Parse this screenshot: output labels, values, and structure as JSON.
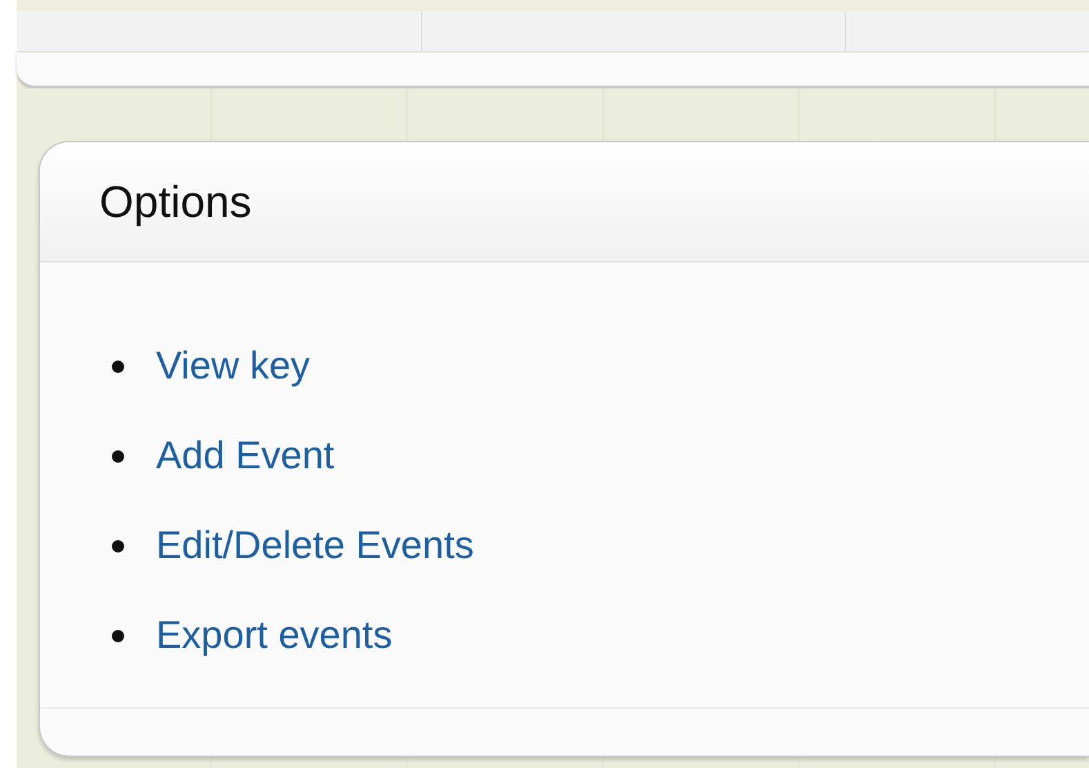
{
  "panel": {
    "title": "Options",
    "links": [
      {
        "label": "View key"
      },
      {
        "label": "Add Event"
      },
      {
        "label": "Edit/Delete Events"
      },
      {
        "label": "Export events"
      }
    ]
  }
}
